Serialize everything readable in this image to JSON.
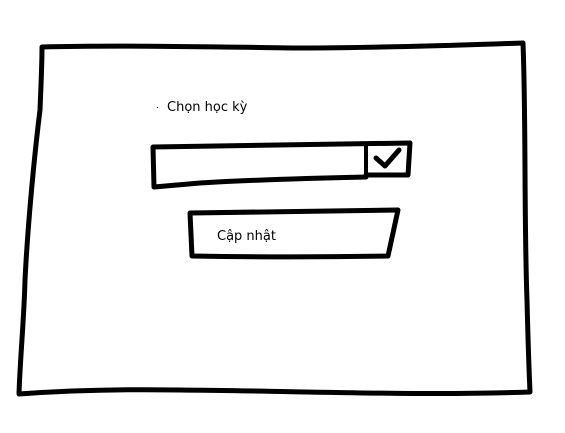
{
  "form": {
    "semester_label": "Chọn học kỳ",
    "semester_select": {
      "selected_value": "",
      "dropdown_icon": "checkmark-icon"
    },
    "update_button_label": "Cập nhật"
  },
  "colors": {
    "stroke": "#000000",
    "background": "#ffffff"
  }
}
